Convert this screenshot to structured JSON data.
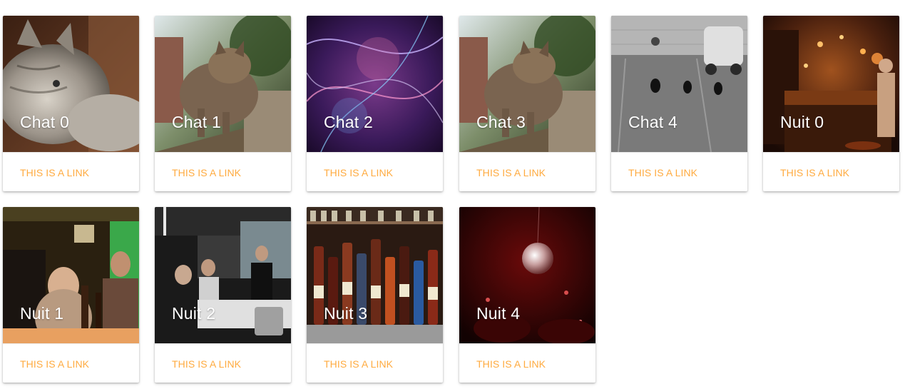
{
  "link_color": "#ffab40",
  "cards": [
    {
      "title": "Chat 0",
      "link": "THIS IS A LINK",
      "image": "cat-portrait-photo"
    },
    {
      "title": "Chat 1",
      "link": "THIS IS A LINK",
      "image": "cat-walking-on-fence-photo"
    },
    {
      "title": "Chat 2",
      "link": "THIS IS A LINK",
      "image": "abstract-purple-light-photo"
    },
    {
      "title": "Chat 3",
      "link": "THIS IS A LINK",
      "image": "cat-walking-on-fence-photo"
    },
    {
      "title": "Chat 4",
      "link": "THIS IS A LINK",
      "image": "three-cats-in-parking-lot-photo"
    },
    {
      "title": "Nuit 0",
      "link": "THIS IS A LINK",
      "image": "bar-interior-warm-lights-photo"
    },
    {
      "title": "Nuit 1",
      "link": "THIS IS A LINK",
      "image": "people-at-bar-green-light-photo"
    },
    {
      "title": "Nuit 2",
      "link": "THIS IS A LINK",
      "image": "crowded-bar-counter-photo"
    },
    {
      "title": "Nuit 3",
      "link": "THIS IS A LINK",
      "image": "liquor-bottles-shelf-photo"
    },
    {
      "title": "Nuit 4",
      "link": "THIS IS A LINK",
      "image": "disco-ball-red-club-photo"
    }
  ]
}
